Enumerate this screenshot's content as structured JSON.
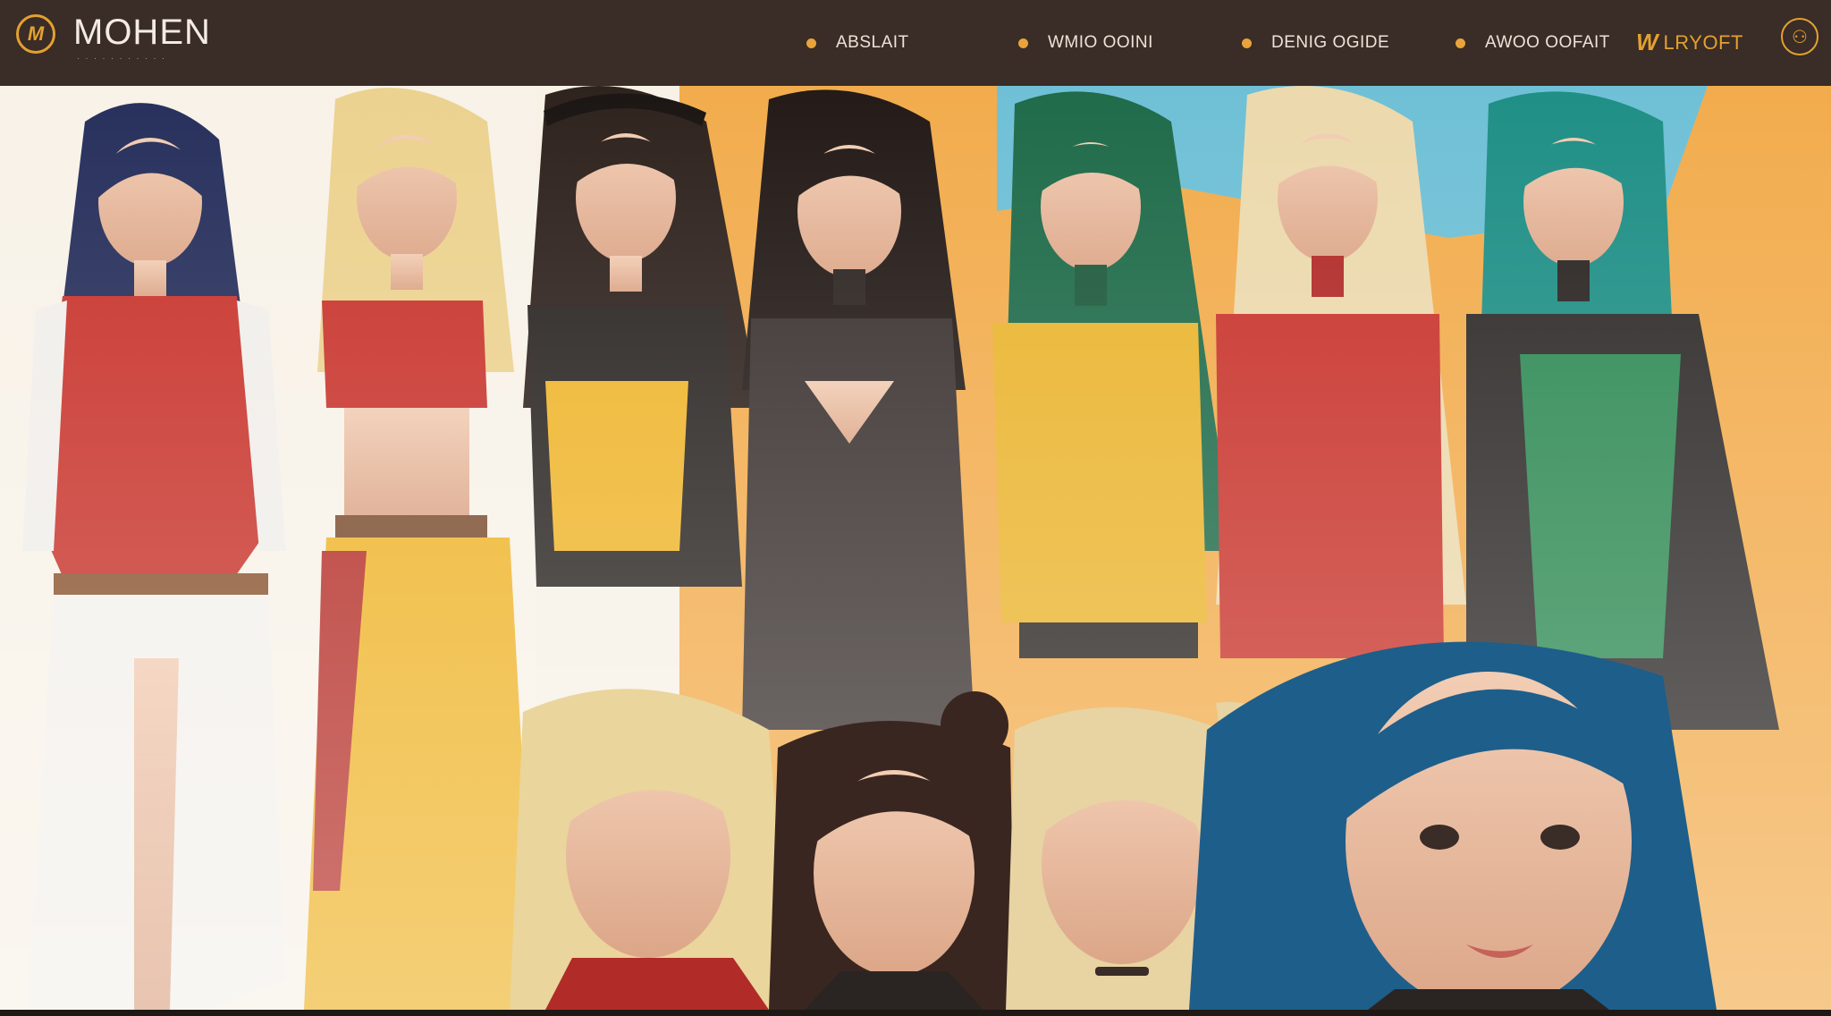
{
  "header": {
    "logo_badge": "M",
    "logo_text": "MOHEN",
    "logo_subtitle": "· · · · · · · · · · ·",
    "nav": [
      {
        "label": "ABSLAIT"
      },
      {
        "label": "WMIO OOINI"
      },
      {
        "label": "DENIG OGIDE"
      },
      {
        "label": "AWOO OOFAIT"
      }
    ],
    "brand_mark": "LRYOFT",
    "brand_icon": "w-brand-icon",
    "user_icon": "circle-logo-icon"
  },
  "colors": {
    "header_bg": "#3a2c26",
    "accent": "#e3a12f",
    "bg_orange": "#f2ac4d",
    "bg_cream": "#f7f1e6",
    "bg_sky": "#6fc0d6"
  },
  "gallery": {
    "figures": [
      {
        "hair": "navy",
        "outfit": "red-white"
      },
      {
        "hair": "blonde",
        "outfit": "red-yellow"
      },
      {
        "hair": "dark-brown",
        "outfit": "yellow-black"
      },
      {
        "hair": "black",
        "outfit": "black"
      },
      {
        "hair": "green",
        "outfit": "yellow"
      },
      {
        "hair": "platinum",
        "outfit": "red"
      },
      {
        "hair": "teal",
        "outfit": "green-black"
      },
      {
        "hair": "blonde",
        "outfit": "red"
      },
      {
        "hair": "brown-bun",
        "outfit": "black"
      },
      {
        "hair": "blonde-ponytail",
        "outfit": "choker"
      },
      {
        "hair": "blue",
        "outfit": "black"
      }
    ]
  }
}
